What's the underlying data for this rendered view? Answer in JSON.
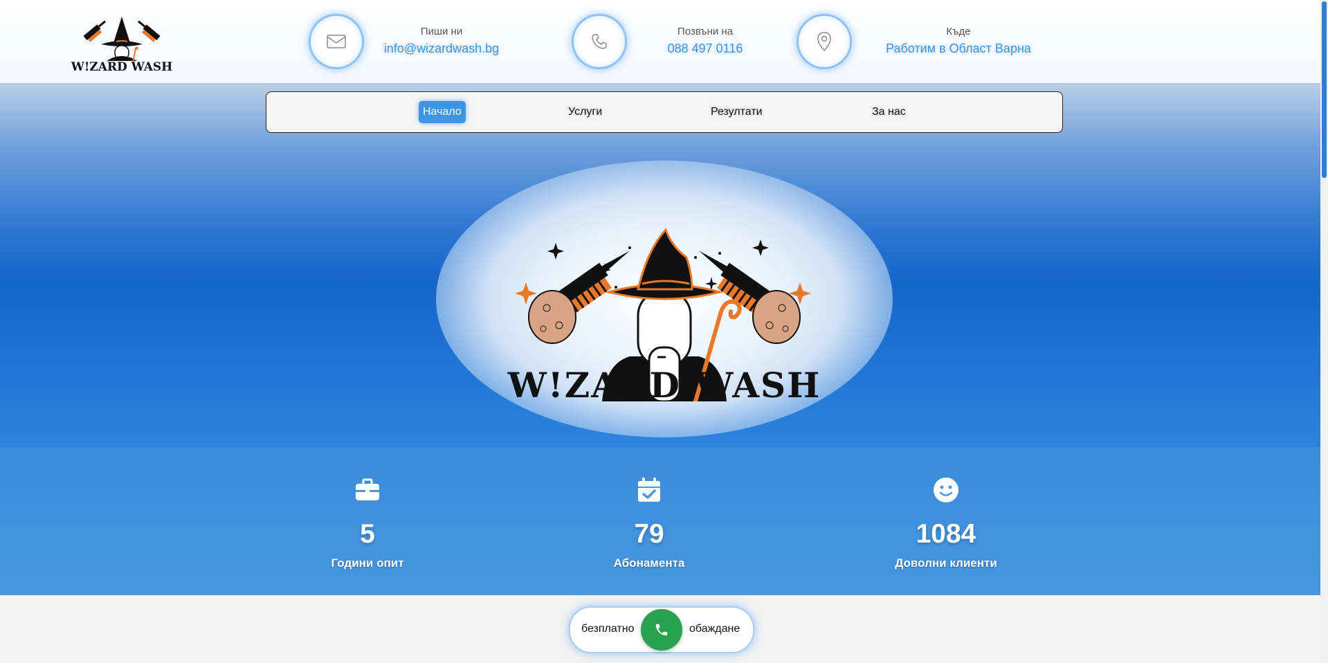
{
  "brand": {
    "name": "WIZARD WASH",
    "logo_text_header": "W!ZARD WASH",
    "logo_text_hero": "W!ZARD WASH"
  },
  "contacts": [
    {
      "label": "Пиши ни",
      "value": "info@wizardwash.bg",
      "icon": "envelope-icon"
    },
    {
      "label": "Позвъни на",
      "value": "088 497 0116",
      "icon": "phone-icon"
    },
    {
      "label": "Къде",
      "value": "Работим в Област Варна",
      "icon": "map-pin-icon"
    }
  ],
  "nav": {
    "items": [
      {
        "label": "Начало",
        "active": true
      },
      {
        "label": "Услуги",
        "active": false
      },
      {
        "label": "Резултати",
        "active": false
      },
      {
        "label": "За нас",
        "active": false
      }
    ]
  },
  "stats": [
    {
      "value": "5",
      "label": "Години опит",
      "icon": "briefcase-icon"
    },
    {
      "value": "79",
      "label": "Абонамента",
      "icon": "calendar-check-icon"
    },
    {
      "value": "1084",
      "label": "Доволни клиенти",
      "icon": "smile-icon"
    }
  ],
  "call": {
    "left_text": "безплатно",
    "right_text": "обаждане"
  },
  "colors": {
    "accent": "#3d94e2",
    "call_green": "#28a150",
    "hat_orange": "#e8782a"
  }
}
